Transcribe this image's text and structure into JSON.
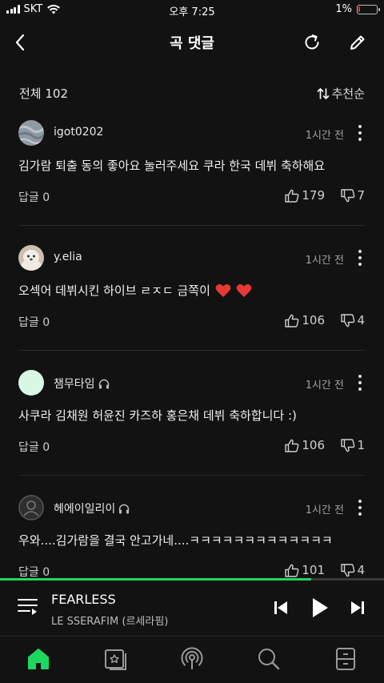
{
  "status_bar": {
    "carrier": "SKT",
    "time": "오후 7:25",
    "battery": "1%"
  },
  "header": {
    "title": "곡 댓글"
  },
  "summary": {
    "count_label": "전체 102",
    "sort_label": "추천순"
  },
  "comments": [
    {
      "username": "igot0202",
      "headphones": false,
      "time": "1시간 전",
      "text": "김가람 퇴출 동의 좋아요 눌러주세요 쿠라 한국 데뷔 축하해요",
      "reply_label": "답글 0",
      "likes": "179",
      "dislikes": "7"
    },
    {
      "username": "y.elia",
      "headphones": false,
      "time": "1시간 전",
      "text": "오섹어 데뷔시킨 하이브 ㄹㅈㄷ 금쪽이",
      "reply_label": "답글 0",
      "likes": "106",
      "dislikes": "4"
    },
    {
      "username": "챔무타임",
      "headphones": true,
      "time": "1시간 전",
      "text": "사쿠라 김채원 허윤진 카즈하 홍은채 데뷔 축하합니다 :)",
      "reply_label": "답글 0",
      "likes": "106",
      "dislikes": "1"
    },
    {
      "username": "헤에이일리이",
      "headphones": true,
      "time": "1시간 전",
      "text": "우와....김가람을 결국 안고가네....ㅋㅋㅋㅋㅋㅋㅋㅋㅋㅋㅋㅋㅋ",
      "reply_label": "답글 0",
      "likes": "101",
      "dislikes": "4"
    }
  ],
  "player": {
    "song": "FEARLESS",
    "artist": "LE SSERAFIM (르세라핌)",
    "progress": 0.81
  },
  "nav": {
    "items": [
      "home-icon",
      "storage-icon",
      "podcast-icon",
      "search-icon",
      "locker-icon"
    ],
    "active": "home-icon"
  },
  "colors": {
    "accent": "#1ed760",
    "background": "#121212",
    "heart": "#e53935"
  }
}
